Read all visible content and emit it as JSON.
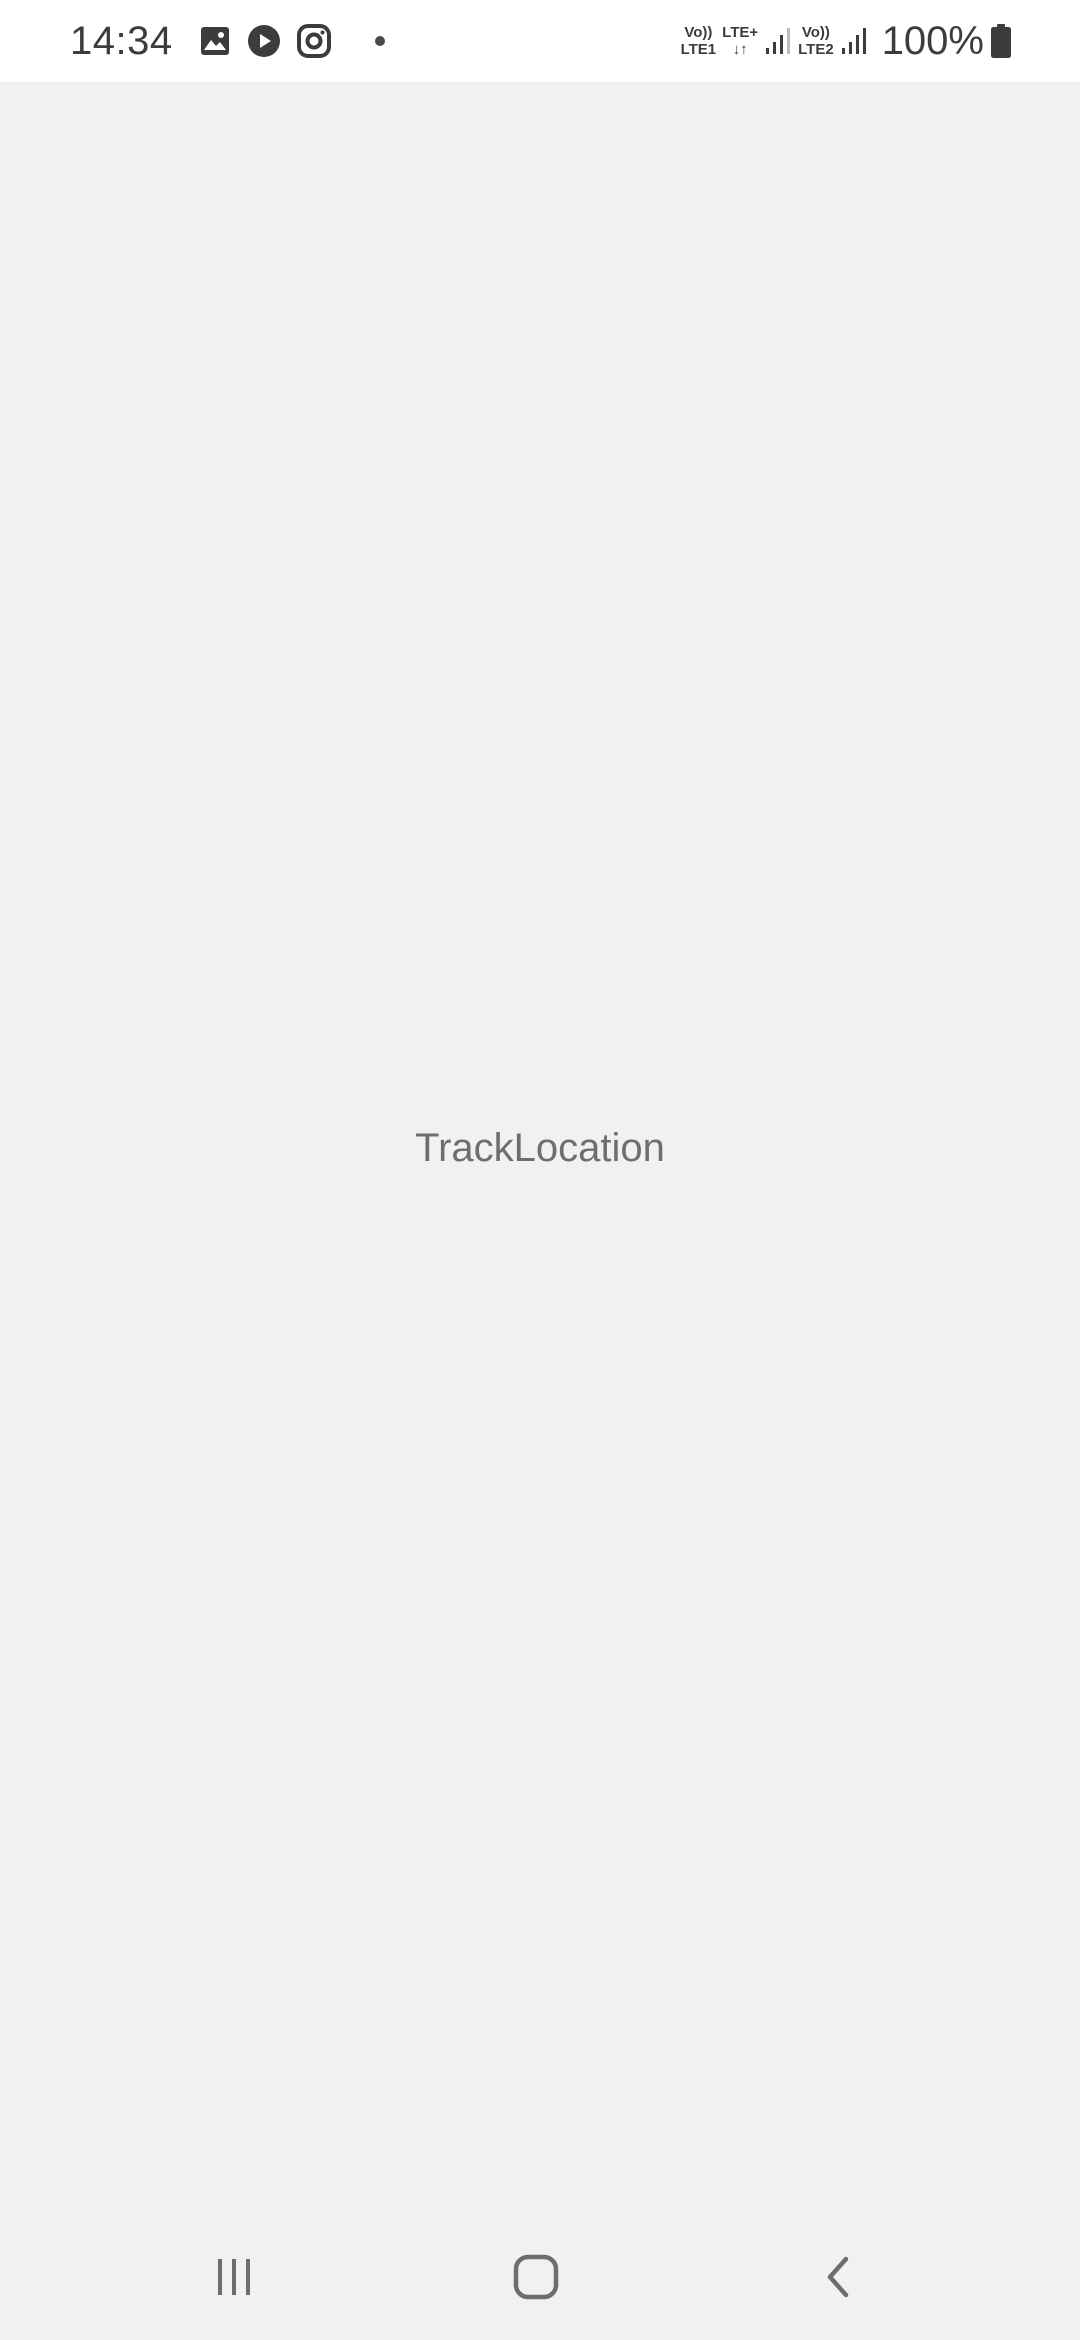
{
  "status_bar": {
    "time": "14:34",
    "notification_icons": [
      "gallery-icon",
      "youtube-icon",
      "instagram-icon",
      "more-notifications-dot"
    ],
    "sim1": {
      "top": "Vo))",
      "bottom": "LTE1"
    },
    "data": {
      "top": "LTE+",
      "bottom": "↓↑"
    },
    "sim2": {
      "top": "Vo))",
      "bottom": "LTE2"
    },
    "battery_text": "100%"
  },
  "main": {
    "label": "TrackLocation"
  },
  "nav_bar": {
    "buttons": [
      "recent-apps",
      "home",
      "back"
    ]
  },
  "colors": {
    "status_bar_bg": "#ffffff",
    "screen_bg": "#f1f1f1",
    "label_text": "#6e6e6e",
    "icon": "#3c3c3c"
  }
}
